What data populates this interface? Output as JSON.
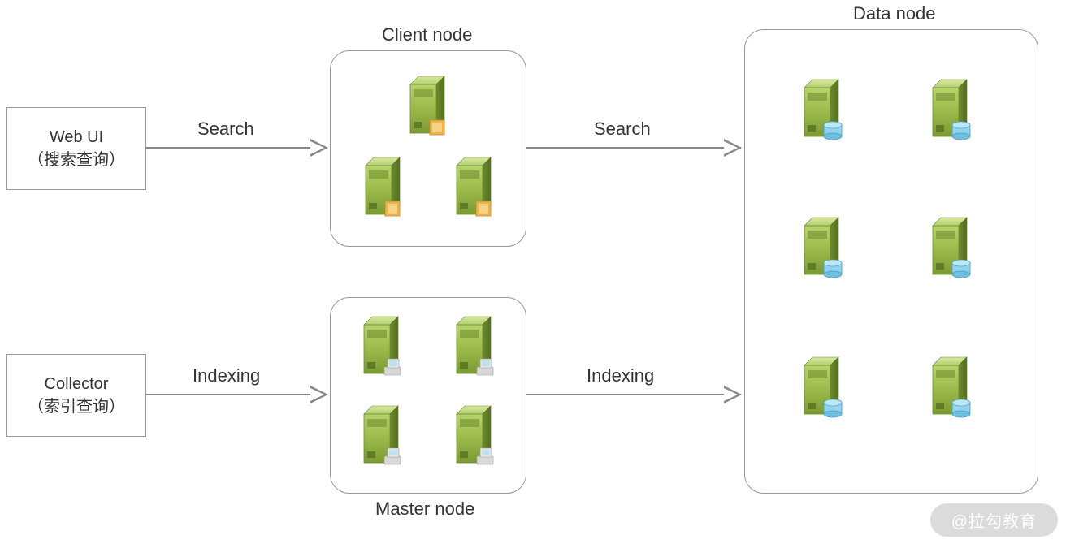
{
  "left_boxes": {
    "web_ui": {
      "line1": "Web UI",
      "line2": "（搜索查询）"
    },
    "collector": {
      "line1": "Collector",
      "line2": "（索引查询）"
    }
  },
  "nodes": {
    "client": "Client node",
    "master": "Master node",
    "data": "Data node"
  },
  "arrows": {
    "search1": "Search",
    "search2": "Search",
    "indexing1": "Indexing",
    "indexing2": "Indexing"
  },
  "watermark": "@拉勾教育"
}
